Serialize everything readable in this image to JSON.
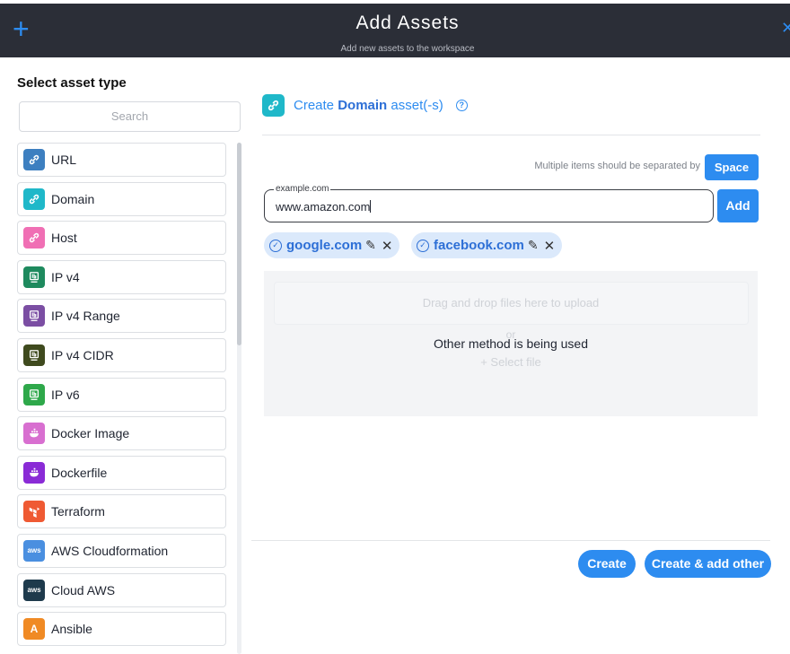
{
  "header": {
    "plus_icon": "plus-icon",
    "title": "Add Assets",
    "subtitle": "Add new assets to the workspace",
    "close_icon": "close-icon"
  },
  "sidebar": {
    "title": "Select asset type",
    "search_placeholder": "Search",
    "items": [
      {
        "label": "URL",
        "icon": "link-icon",
        "color": "#3d7fc0"
      },
      {
        "label": "Domain",
        "icon": "link-icon",
        "color": "#1fb8c9"
      },
      {
        "label": "Host",
        "icon": "link-icon",
        "color": "#f06fb4"
      },
      {
        "label": "IP v4",
        "icon": "ip-icon",
        "color": "#1e8a5e"
      },
      {
        "label": "IP v4 Range",
        "icon": "ip-icon",
        "color": "#7b4ea3"
      },
      {
        "label": "IP v4 CIDR",
        "icon": "ip-icon",
        "color": "#3f4a1e"
      },
      {
        "label": "IP v6",
        "icon": "ip-icon",
        "color": "#2ea84a"
      },
      {
        "label": "Docker Image",
        "icon": "docker-icon",
        "color": "#d86fd0"
      },
      {
        "label": "Dockerfile",
        "icon": "docker-icon",
        "color": "#8a2bd6"
      },
      {
        "label": "Terraform",
        "icon": "terraform-icon",
        "color": "#ef5a33"
      },
      {
        "label": "AWS Cloudformation",
        "icon": "aws-icon",
        "color": "#4a8fe0"
      },
      {
        "label": "Cloud AWS",
        "icon": "aws-icon",
        "color": "#1e3a4c"
      },
      {
        "label": "Ansible",
        "icon": "ansible-icon",
        "color": "#f08a24"
      }
    ]
  },
  "main": {
    "heading_prefix": "Create ",
    "heading_type": "Domain",
    "heading_suffix": " asset(-s)",
    "separator_hint": "Multiple items should be separated by",
    "space_label": "Space",
    "input_legend": "example.com",
    "input_value": "www.amazon.com",
    "add_label": "Add",
    "chips": [
      {
        "label": "google.com"
      },
      {
        "label": "facebook.com"
      }
    ],
    "dropzone": {
      "drag_text": "Drag and drop files here to upload",
      "or_text": "or",
      "select_text": "Select file",
      "overlay_message": "Other method is being used"
    }
  },
  "footer": {
    "create_label": "Create",
    "create_add_other_label": "Create & add other"
  },
  "colors": {
    "accent": "#2d8cf0",
    "header_bg": "#2b2e37",
    "chip_bg": "#dbe9fb"
  }
}
